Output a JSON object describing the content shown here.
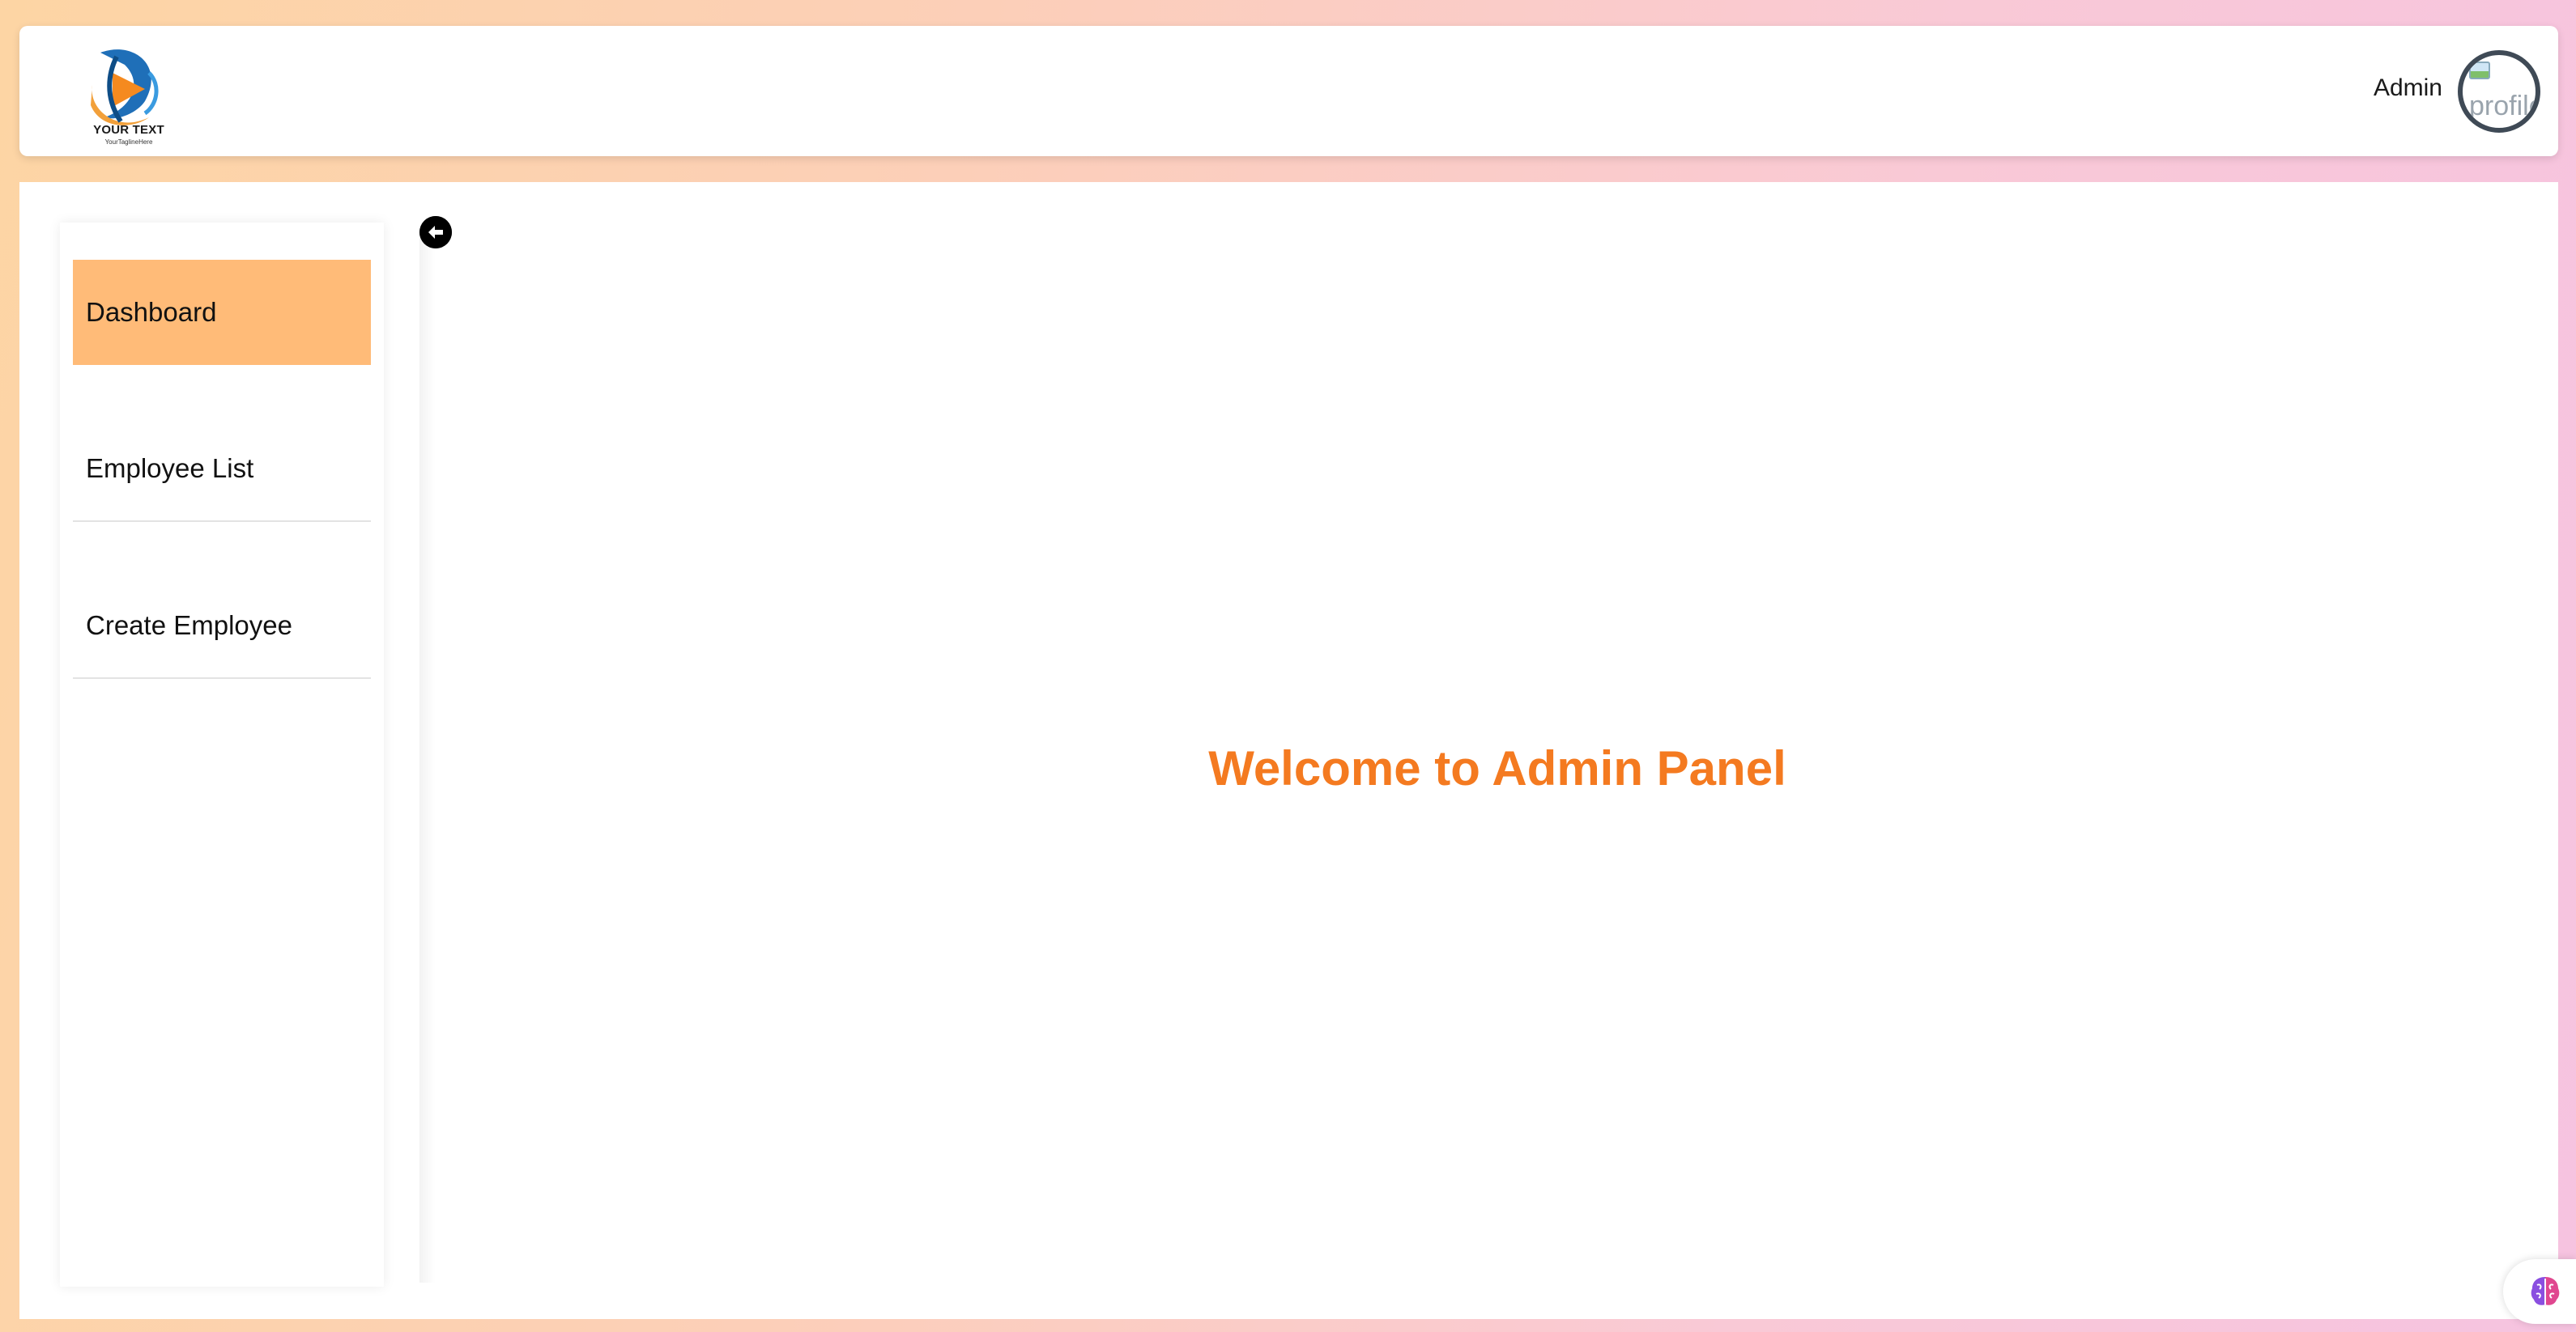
{
  "header": {
    "logo_text": "YOUR TEXT",
    "logo_tagline": "YourTaglineHere",
    "user_label": "Admin",
    "avatar_alt": "profile"
  },
  "sidebar": {
    "items": [
      {
        "label": "Dashboard",
        "active": true
      },
      {
        "label": "Employee List",
        "active": false
      },
      {
        "label": "Create Employee",
        "active": false
      }
    ]
  },
  "main": {
    "welcome_text": "Welcome to Admin Panel"
  },
  "icons": {
    "logo": "logo-icon",
    "collapse": "arrow-left-circle-icon",
    "extension": "brain-icon"
  },
  "colors": {
    "accent_text": "#f47a20",
    "active_item_bg": "#ffbb78"
  }
}
